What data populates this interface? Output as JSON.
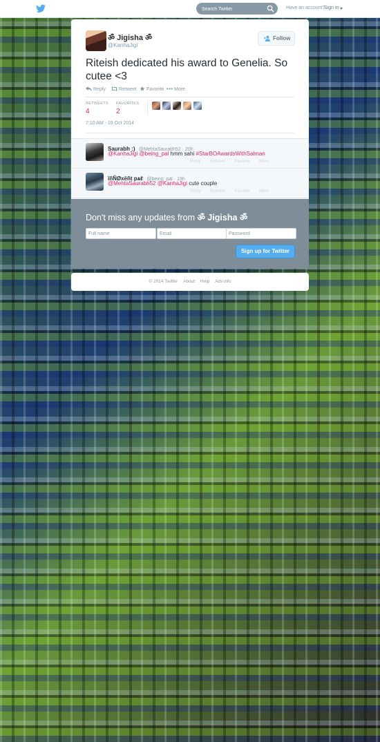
{
  "topbar": {
    "search_placeholder": "Search Twitter",
    "account_text": "Have an account?",
    "signin_label": "Sign in"
  },
  "tweet": {
    "fullname": "ॐ Jigisha ॐ",
    "username": "@KanhaJigi",
    "follow_label": "Follow",
    "text": "Riteish dedicated his award to Genelia. So cutee <3",
    "actions": {
      "reply": "Reply",
      "retweet": "Retweet",
      "favorite": "Favorite",
      "more": "More"
    },
    "stats": {
      "retweets_label": "RETWEETS",
      "retweets_value": "4",
      "favorites_label": "FAVORITES",
      "favorites_value": "2"
    },
    "timestamp": "7:10 AM - 19 Oct 2014"
  },
  "replies": [
    {
      "name": "Saurabh :)",
      "handle": "@MehtaSaurabh52 · 20h",
      "mention1": "@KanhaJigi",
      "mention2": "@being_pal",
      "text": " hmm sahi ",
      "hashtag": "#StarBOAwardsWithSalman",
      "actions": {
        "reply": "Reply",
        "retweet": "Retweet",
        "favorite": "Favorite",
        "more": "More"
      }
    },
    {
      "name": "ïñÑØxëñt pѧℓ",
      "handle": "@being_pal · 19h",
      "mention1": "@MehtaSaurabh52",
      "mention2": "@KanhaJigi",
      "text": " cute couple",
      "actions": {
        "reply": "Reply",
        "retweet": "Retweet",
        "favorite": "Favorite",
        "more": "More"
      }
    }
  ],
  "signup": {
    "title_prefix": "Don't miss any updates from ",
    "title_name": "ॐ Jigisha ॐ",
    "fullname_placeholder": "Full name",
    "email_placeholder": "Email",
    "password_placeholder": "Password",
    "button_label": "Sign up for Twitter"
  },
  "footer": {
    "copyright": "© 2014 Twitter",
    "about": "About",
    "help": "Help",
    "ads_info": "Ads info"
  },
  "colors": {
    "brand_blue": "#55acee",
    "count_red": "#e0245e",
    "signup_bg": "#7e8d98"
  }
}
